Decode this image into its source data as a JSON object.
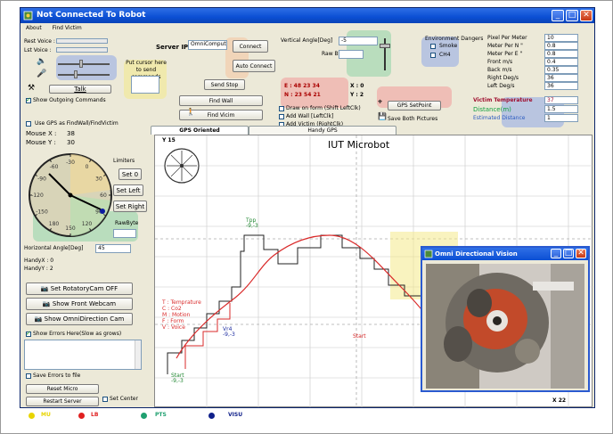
{
  "window": {
    "title": "Not Connected To Robot",
    "menu": [
      "About",
      "Find Victim"
    ]
  },
  "voice": {
    "rest_label": "Rest Voice :",
    "lst_label": "Lst Voice :",
    "talk_label": "Talk",
    "cursor_hint": "Put cursor here to send commands",
    "show_outgoing": "Show Outgoing Commands"
  },
  "server": {
    "ip_label": "Server IP",
    "ip_value": "OmniComputer",
    "connect": "Connect",
    "auto_connect": "Auto Connect",
    "send_stop": "Send Stop",
    "find_wall": "Find Wall",
    "find_vicim": "Find Vicim"
  },
  "vertical": {
    "angle_label": "Vertical Angle[Deg]",
    "angle_value": "-5",
    "raw_label": "Raw Byte"
  },
  "coords": {
    "e": "E : 48 23 34",
    "n": "N : 23 54 21",
    "x": "X : 0",
    "y": "Y : 2"
  },
  "draw": {
    "draw_on_form": "Draw on form (Shift LeftClk)",
    "add_wall": "Add Wall  [LeftClk]",
    "add_victim": "Add Victim (RightClk)",
    "gps_setpoint": "GPS SetPoint",
    "save_both": "Save Both Pictures"
  },
  "env": {
    "title": "Environment Dangers",
    "smoke": "Smoke",
    "ch4": "CH4"
  },
  "params": [
    {
      "label": "Pixel Per Meter",
      "value": "10"
    },
    {
      "label": "Meter Per N \"",
      "value": "0.8"
    },
    {
      "label": "Meter Per E \"",
      "value": "0.8"
    },
    {
      "label": "Front m/s",
      "value": "0.4"
    },
    {
      "label": "Back m/s",
      "value": "0.35"
    },
    {
      "label": "Right Deg/s",
      "value": "36"
    },
    {
      "label": "Left  Deg/s",
      "value": "36"
    }
  ],
  "victim": {
    "temp_label": "Victim Temperature",
    "temp_value": "37",
    "dist_label": "Distance(m)",
    "dist_value": "1.5",
    "est_label": "Estimated Distance",
    "est_value": "1"
  },
  "mouse": {
    "use_gps": "Use GPS as FindWall/FindVictim",
    "mx_label": "Mouse X :",
    "mx_value": "38",
    "my_label": "Mouse Y :",
    "my_value": "30"
  },
  "compass": {
    "limiters": "Limiters",
    "set0": "Set 0",
    "set_left": "Set Left",
    "set_right": "Set Right",
    "rawbyte": "RawByte",
    "h_angle_label": "Horizontal Angle[Deg]",
    "h_angle_value": "45",
    "ticks": [
      "-30",
      "0",
      "30",
      "60",
      "90",
      "120",
      "150",
      "180",
      "-150",
      "-120",
      "-90",
      "-60"
    ],
    "handy_x": "HandyX : 0",
    "handy_y": "HandyY : 2"
  },
  "cams": {
    "rotatory": "Set RotatoryCam OFF",
    "front": "Show Front Webcam",
    "omni": "Show OmniDirection Cam"
  },
  "errors": {
    "show": "Show Errors Here(Slow as grows)",
    "save": "Save Errors to file",
    "reset_micro": "Reset Micro",
    "restart_server": "Restart Server",
    "set_center": "Set Center"
  },
  "map": {
    "tabs": [
      "GPS Oriented",
      "Handy GPS"
    ],
    "title": "IUT Microbot",
    "y_label": "Y 15",
    "x_label": "X 22",
    "legend_lines": [
      "T : Temprature",
      "C : Co2",
      "M : Motion",
      "F : Form",
      "V : Voice"
    ],
    "points": [
      {
        "name": "Tpp",
        "sub": "-9,-3"
      },
      {
        "name": "Vr4",
        "sub": "-9,-3"
      },
      {
        "name": "Start",
        "sub": ""
      },
      {
        "name": "Start",
        "sub": "-9,-3"
      }
    ]
  },
  "omni": {
    "title": "Omni Directional Vision"
  },
  "legend": [
    {
      "label": "MU",
      "color": "#e8d400"
    },
    {
      "label": "LB",
      "color": "#e02020"
    },
    {
      "label": "PTS",
      "color": "#20a070"
    },
    {
      "label": "VISU",
      "color": "#10208a"
    }
  ],
  "colors": {
    "title_blue": "#0b4fd4",
    "blob_blue": "#8fa8e8",
    "blob_green": "#8fd4a8",
    "blob_yellow": "#f4e98a",
    "blob_red": "#f29a9a",
    "path_red": "#d92a2a",
    "path_black": "#222222"
  }
}
